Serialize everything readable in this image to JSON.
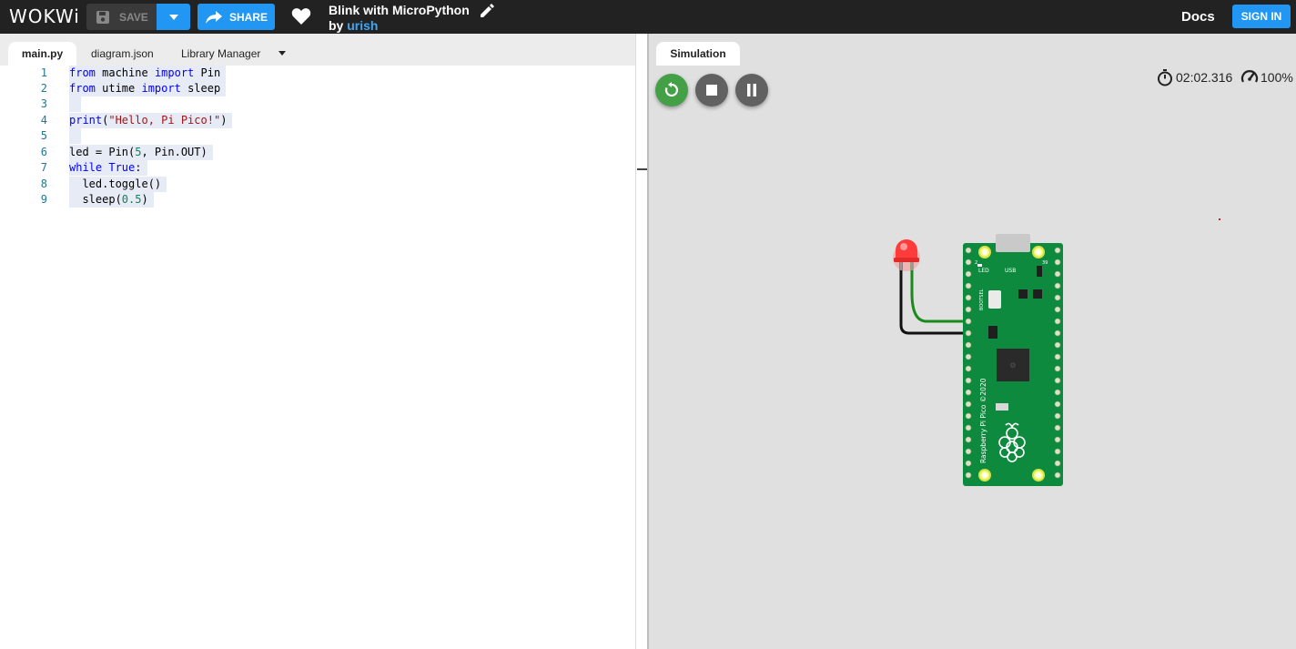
{
  "header": {
    "logo": "WOKWi",
    "save_label": "SAVE",
    "share_label": "SHARE",
    "project_title": "Blink with MicroPython",
    "by_prefix": "by",
    "author": "urish",
    "docs_label": "Docs",
    "signin_label": "SIGN IN"
  },
  "editor": {
    "tabs": [
      {
        "label": "main.py",
        "active": true
      },
      {
        "label": "diagram.json",
        "active": false
      },
      {
        "label": "Library Manager",
        "active": false
      }
    ],
    "line_numbers": [
      "1",
      "2",
      "3",
      "4",
      "5",
      "6",
      "7",
      "8",
      "9"
    ],
    "code_lines": [
      "from machine import Pin",
      "from utime import sleep",
      "",
      "print(\"Hello, Pi Pico!\")",
      "",
      "led = Pin(5, Pin.OUT)",
      "while True:",
      "  led.toggle()",
      "  sleep(0.5)"
    ]
  },
  "simulation": {
    "tab_label": "Simulation",
    "elapsed_time": "02:02.316",
    "speed": "100%",
    "board_text": "Raspberry Pi Pico ©2020",
    "board_labels": {
      "led": "LED",
      "usb": "USB",
      "bootsel": "BOOTSEL",
      "pin_left": "2",
      "pin_right": "39"
    }
  },
  "colors": {
    "header_bg": "#222222",
    "accent_blue": "#2196f3",
    "run_green": "#43a047",
    "control_grey": "#616161",
    "board_green": "#0e8a3e",
    "led_red": "#ff3b3b",
    "wire_green": "#1a8a1a"
  }
}
